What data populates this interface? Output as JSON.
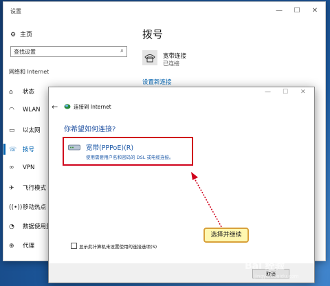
{
  "settings": {
    "window_title": "设置",
    "home_label": "主页",
    "search_placeholder": "查找设置",
    "section_title": "网络和 Internet",
    "nav": [
      {
        "label": "状态",
        "icon": "home-network-icon"
      },
      {
        "label": "WLAN",
        "icon": "wifi-icon"
      },
      {
        "label": "以太网",
        "icon": "ethernet-icon"
      },
      {
        "label": "拨号",
        "icon": "dialup-icon"
      },
      {
        "label": "VPN",
        "icon": "vpn-icon"
      },
      {
        "label": "飞行模式",
        "icon": "airplane-icon"
      },
      {
        "label": "移动热点",
        "icon": "hotspot-icon"
      },
      {
        "label": "数据使用量",
        "icon": "data-usage-icon"
      },
      {
        "label": "代理",
        "icon": "globe-icon"
      }
    ],
    "active_nav": "拨号",
    "page_heading": "拨号",
    "connection": {
      "name": "宽带连接",
      "status": "已连接"
    },
    "new_connection_link": "设置新连接"
  },
  "dialog": {
    "title": "连接到 Internet",
    "question": "你希望如何连接?",
    "option": {
      "title": "宽带(PPPoE)(R)",
      "description": "使用需要用户名和密码的 DSL 或电缆连接。"
    },
    "checkbox_label": "显示此计算机未设置使用的连接选项(S)",
    "cancel_label": "取消"
  },
  "annotation": {
    "text": "选择并继续"
  },
  "watermark": {
    "text": "Bai 经验",
    "sub": "jingyan.baidu.com"
  },
  "colors": {
    "accent": "#0063b1",
    "highlight_border": "#d0021b",
    "callout_bg": "#fff7b0",
    "desktop": "#1e5fa8"
  }
}
